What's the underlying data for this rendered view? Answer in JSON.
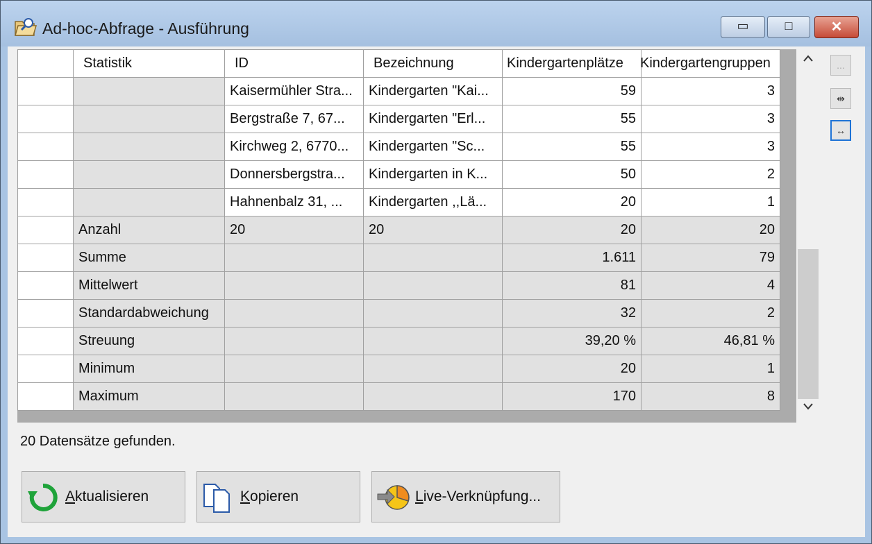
{
  "window": {
    "title": "Ad-hoc-Abfrage - Ausführung",
    "controls": {
      "minimize": "▭",
      "maximize": "□",
      "close": "✕"
    }
  },
  "grid": {
    "columns": [
      "Statistik",
      "ID",
      "Bezeichnung",
      "Kindergartenplätze",
      "Kindergartengruppen"
    ],
    "data_rows": [
      {
        "id": "Kaisermühler Stra...",
        "bezeichnung": "Kindergarten \"Kai...",
        "plaetze": "59",
        "gruppen": "3"
      },
      {
        "id": "Bergstraße 7, 67...",
        "bezeichnung": "Kindergarten \"Erl...",
        "plaetze": "55",
        "gruppen": "3"
      },
      {
        "id": "Kirchweg 2, 6770...",
        "bezeichnung": "Kindergarten \"Sc...",
        "plaetze": "55",
        "gruppen": "3"
      },
      {
        "id": "Donnersbergstra...",
        "bezeichnung": "Kindergarten in K...",
        "plaetze": "50",
        "gruppen": "2"
      },
      {
        "id": "Hahnenbalz 31, ...",
        "bezeichnung": "Kindergarten ,,Lä...",
        "plaetze": "20",
        "gruppen": "1"
      }
    ],
    "stat_rows": [
      {
        "label": "Anzahl",
        "id": "20",
        "bezeichnung": "20",
        "plaetze": "20",
        "gruppen": "20"
      },
      {
        "label": "Summe",
        "id": "",
        "bezeichnung": "",
        "plaetze": "1.611",
        "gruppen": "79"
      },
      {
        "label": "Mittelwert",
        "id": "",
        "bezeichnung": "",
        "plaetze": "81",
        "gruppen": "4"
      },
      {
        "label": "Standardabweichung",
        "id": "",
        "bezeichnung": "",
        "plaetze": "32",
        "gruppen": "2"
      },
      {
        "label": "Streuung",
        "id": "",
        "bezeichnung": "",
        "plaetze": "39,20 %",
        "gruppen": "46,81 %"
      },
      {
        "label": "Minimum",
        "id": "",
        "bezeichnung": "",
        "plaetze": "20",
        "gruppen": "1"
      },
      {
        "label": "Maximum",
        "id": "",
        "bezeichnung": "",
        "plaetze": "170",
        "gruppen": "8"
      }
    ]
  },
  "scrollbar": {
    "up": "^",
    "down": "v"
  },
  "side_buttons": {
    "b1": "...",
    "b2": "⇹",
    "b3": "↔"
  },
  "status": "20 Datensätze gefunden.",
  "buttons": {
    "refresh": {
      "mnemonic": "A",
      "rest": "ktualisieren"
    },
    "copy": {
      "mnemonic": "K",
      "rest": "opieren"
    },
    "live": {
      "mnemonic": "L",
      "rest": "ive-Verknüpfung..."
    }
  },
  "colors": {
    "titlebar": "#bcd3ee",
    "client": "#f0f0f0",
    "grid_bg": "#ababab",
    "stat_cell": "#e1e1e1",
    "close_red": "#c64b37",
    "focus_blue": "#1e73d6"
  }
}
